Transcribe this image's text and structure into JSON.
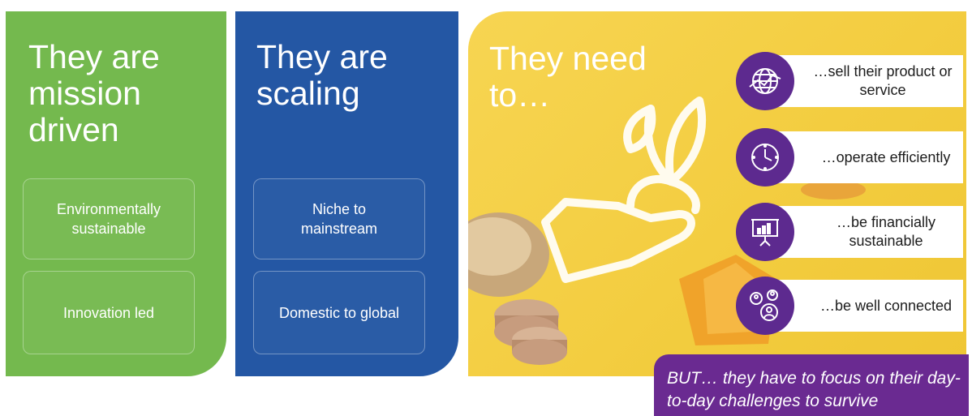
{
  "panels": {
    "mission": {
      "heading": "They are mission driven",
      "cards": [
        "Environmentally sustainable",
        "Innovation led"
      ]
    },
    "scaling": {
      "heading": "They are scaling",
      "cards": [
        "Niche to mainstream",
        "Domestic to global"
      ]
    },
    "needs": {
      "heading": "They need to…",
      "items": [
        {
          "label": "…sell their product or service",
          "icon": "globe-network-icon"
        },
        {
          "label": "…operate efficiently",
          "icon": "clock-icon"
        },
        {
          "label": "…be financially sustainable",
          "icon": "presentation-chart-icon"
        },
        {
          "label": "…be well connected",
          "icon": "people-network-icon"
        }
      ]
    }
  },
  "note": "BUT… they have to focus on their day-to-day challenges to survive",
  "colors": {
    "green": "#74b94e",
    "blue": "#2457a4",
    "yellow": "#f3cd40",
    "purple": "#5d2a8f"
  }
}
